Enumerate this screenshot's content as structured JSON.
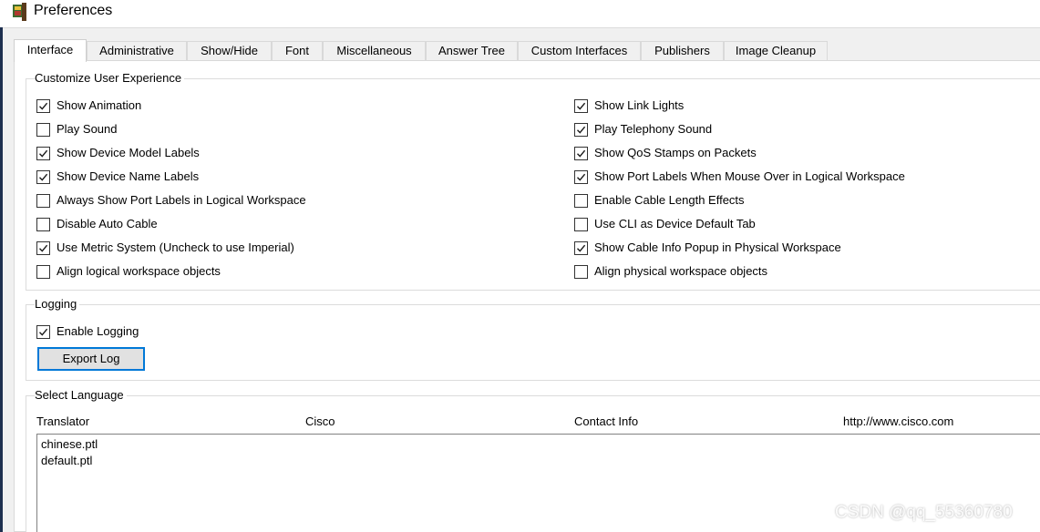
{
  "window": {
    "title": "Preferences"
  },
  "tabs": [
    {
      "label": "Interface",
      "active": true
    },
    {
      "label": "Administrative"
    },
    {
      "label": "Show/Hide"
    },
    {
      "label": "Font"
    },
    {
      "label": "Miscellaneous"
    },
    {
      "label": "Answer Tree"
    },
    {
      "label": "Custom Interfaces"
    },
    {
      "label": "Publishers"
    },
    {
      "label": "Image Cleanup"
    }
  ],
  "customize": {
    "title": "Customize User Experience",
    "left": [
      {
        "label": "Show Animation",
        "checked": true
      },
      {
        "label": "Play Sound",
        "checked": false
      },
      {
        "label": "Show Device Model Labels",
        "checked": true
      },
      {
        "label": "Show Device Name Labels",
        "checked": true
      },
      {
        "label": "Always Show Port Labels in Logical Workspace",
        "checked": false
      },
      {
        "label": "Disable Auto Cable",
        "checked": false
      },
      {
        "label": "Use Metric System (Uncheck to use Imperial)",
        "checked": true
      },
      {
        "label": "Align logical workspace objects",
        "checked": false
      }
    ],
    "right": [
      {
        "label": "Show Link Lights",
        "checked": true
      },
      {
        "label": "Play Telephony Sound",
        "checked": true
      },
      {
        "label": "Show QoS Stamps on Packets",
        "checked": true
      },
      {
        "label": "Show Port Labels When Mouse Over in Logical Workspace",
        "checked": true
      },
      {
        "label": "Enable Cable Length Effects",
        "checked": false
      },
      {
        "label": "Use CLI as Device Default Tab",
        "checked": false
      },
      {
        "label": "Show Cable Info Popup in Physical Workspace",
        "checked": true
      },
      {
        "label": "Align physical workspace objects",
        "checked": false
      }
    ]
  },
  "logging": {
    "title": "Logging",
    "enable_label": "Enable Logging",
    "enable_checked": true,
    "export_button": "Export Log"
  },
  "language": {
    "title": "Select Language",
    "headers": [
      "Translator",
      "Cisco",
      "Contact Info",
      "http://www.cisco.com"
    ],
    "items": [
      "chinese.ptl",
      "default.ptl"
    ]
  },
  "watermark": "CSDN @qq_55360780"
}
